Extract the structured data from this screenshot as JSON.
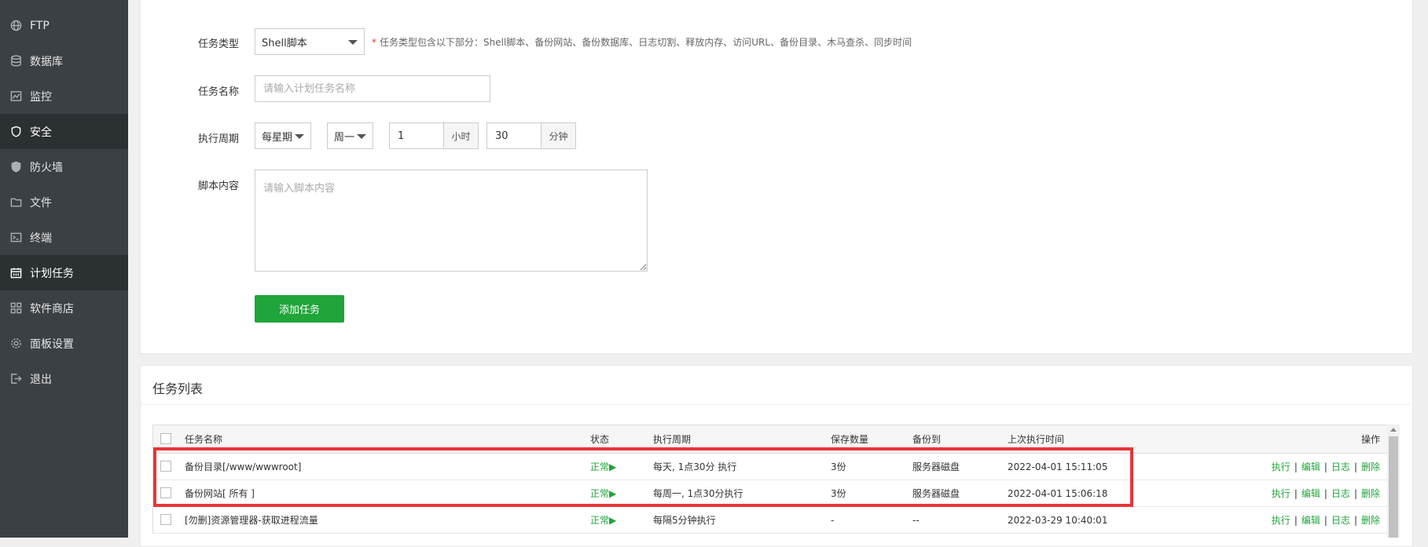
{
  "sidebar": {
    "items": [
      {
        "label": "FTP",
        "icon": "globe-icon",
        "active": false
      },
      {
        "label": "数据库",
        "icon": "database-icon",
        "active": false
      },
      {
        "label": "监控",
        "icon": "monitor-icon",
        "active": false
      },
      {
        "label": "安全",
        "icon": "shield-icon",
        "active": true
      },
      {
        "label": "防火墙",
        "icon": "firewall-icon",
        "active": false
      },
      {
        "label": "文件",
        "icon": "folder-icon",
        "active": false
      },
      {
        "label": "终端",
        "icon": "terminal-icon",
        "active": false
      },
      {
        "label": "计划任务",
        "icon": "calendar-icon",
        "active": true
      },
      {
        "label": "软件商店",
        "icon": "apps-icon",
        "active": false
      },
      {
        "label": "面板设置",
        "icon": "gear-icon",
        "active": false
      },
      {
        "label": "退出",
        "icon": "logout-icon",
        "active": false
      }
    ]
  },
  "form": {
    "task_type_label": "任务类型",
    "task_type_value": "Shell脚本",
    "task_type_hint_star": "*",
    "task_type_hint": "任务类型包含以下部分：Shell脚本、备份网站、备份数据库、日志切割、释放内存、访问URL、备份目录、木马查杀、同步时间",
    "task_name_label": "任务名称",
    "task_name_placeholder": "请输入计划任务名称",
    "cycle_label": "执行周期",
    "cycle_type": "每星期",
    "cycle_weekday": "周一",
    "cycle_hour": "1",
    "cycle_hour_unit": "小时",
    "cycle_minute": "30",
    "cycle_minute_unit": "分钟",
    "script_label": "脚本内容",
    "script_placeholder": "请输入脚本内容",
    "add_button": "添加任务"
  },
  "list": {
    "title": "任务列表",
    "headers": {
      "name": "任务名称",
      "status": "状态",
      "cycle": "执行周期",
      "keep": "保存数量",
      "backup_to": "备份到",
      "last_run": "上次执行时间",
      "ops": "操作"
    },
    "rows": [
      {
        "name": "备份目录[/www/wwwroot]",
        "status": "正常▶",
        "cycle": "每天, 1点30分 执行",
        "keep": "3份",
        "backup_to": "服务器磁盘",
        "last_run": "2022-04-01 15:11:05"
      },
      {
        "name": "备份网站[ 所有 ]",
        "status": "正常▶",
        "cycle": "每周一, 1点30分执行",
        "keep": "3份",
        "backup_to": "服务器磁盘",
        "last_run": "2022-04-01 15:06:18"
      },
      {
        "name": "[勿删]资源管理器-获取进程流量",
        "status": "正常▶",
        "cycle": "每隔5分钟执行",
        "keep": "-",
        "backup_to": "--",
        "last_run": "2022-03-29 10:40:01"
      }
    ],
    "ops": {
      "run": "执行",
      "edit": "编辑",
      "log": "日志",
      "delete": "删除",
      "sep": "|"
    }
  },
  "colors": {
    "sidebar_bg": "#3b4044",
    "accent_green": "#20a53a",
    "highlight_red": "#e8353a"
  }
}
